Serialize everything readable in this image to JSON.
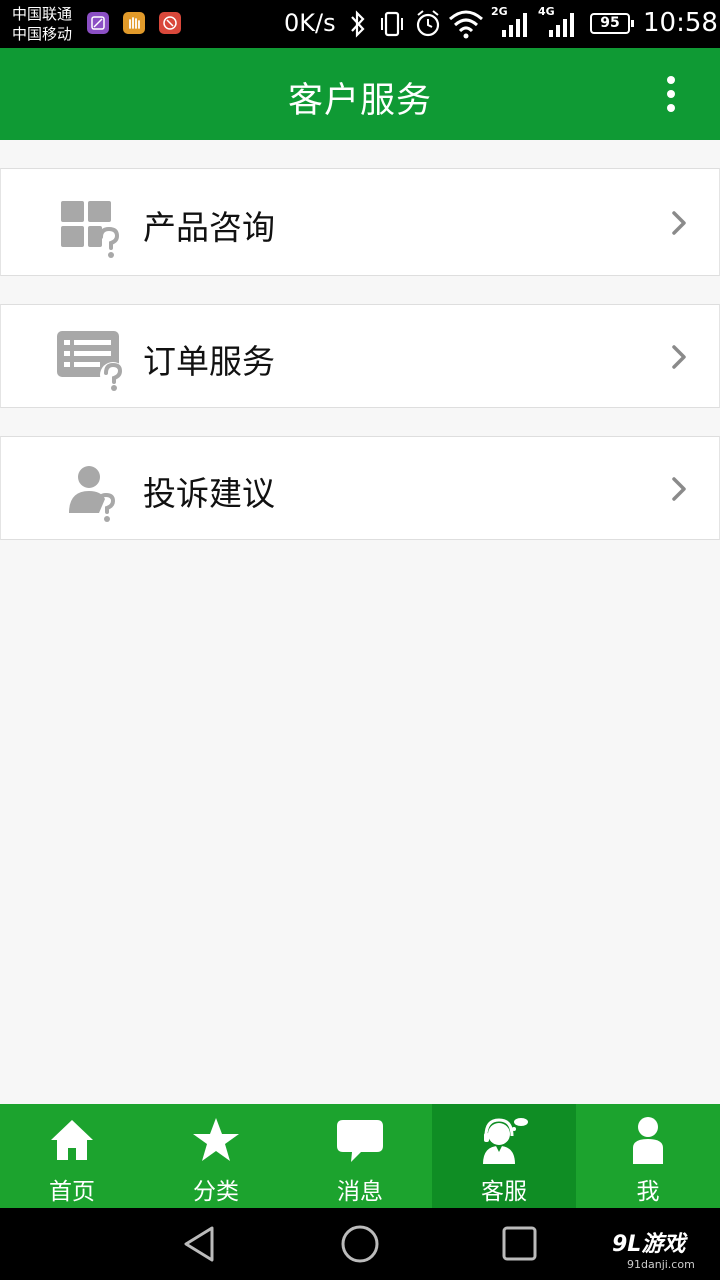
{
  "status_bar": {
    "carrier_1": "中国联通",
    "carrier_2": "中国移动",
    "net_speed": "0K/s",
    "network_1": "2G",
    "network_2": "4G",
    "battery": "95",
    "time": "10:58"
  },
  "header": {
    "title": "客户服务",
    "menu_icon": "more-vertical-icon"
  },
  "menu": [
    {
      "label": "产品咨询",
      "icon": "product-question-icon"
    },
    {
      "label": "订单服务",
      "icon": "order-question-icon"
    },
    {
      "label": "投诉建议",
      "icon": "user-question-icon"
    }
  ],
  "bottom_nav": {
    "active_index": 3,
    "items": [
      {
        "label": "首页",
        "icon": "home-icon"
      },
      {
        "label": "分类",
        "icon": "star-icon"
      },
      {
        "label": "消息",
        "icon": "chat-bubble-icon"
      },
      {
        "label": "客服",
        "icon": "customer-service-icon"
      },
      {
        "label": "我",
        "icon": "person-icon"
      }
    ]
  },
  "watermark": {
    "brand": "9L游戏",
    "domain": "91danji.com"
  },
  "colors": {
    "header_green": "#0f9a34",
    "nav_green": "#1ca32e",
    "nav_active": "#0f8d24",
    "icon_gray": "#a8a8a8"
  }
}
